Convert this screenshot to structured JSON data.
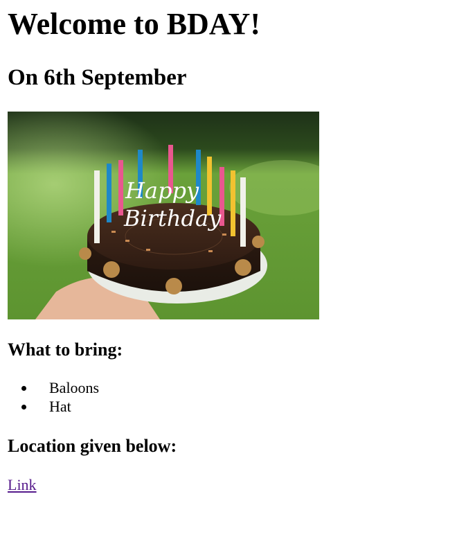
{
  "heading": {
    "title": "Welcome to BDAY!",
    "date": "On 6th September"
  },
  "image": {
    "description_icon": "birthday-cake-photo",
    "topper_text_1": "Happy",
    "topper_text_2": "Birthday",
    "colors": {
      "background_green": "#6aa13a",
      "cake_brown": "#3a2317",
      "candle_pink": "#e9578f",
      "candle_blue": "#1e88c8",
      "candle_yellow": "#f2c230",
      "candle_white": "#f1f1ea"
    }
  },
  "bring": {
    "heading": "What to bring:",
    "items": [
      "Baloons",
      "Hat"
    ]
  },
  "location": {
    "heading": "Location given below:",
    "link_label": "Link",
    "link_color": "#551a8b"
  }
}
